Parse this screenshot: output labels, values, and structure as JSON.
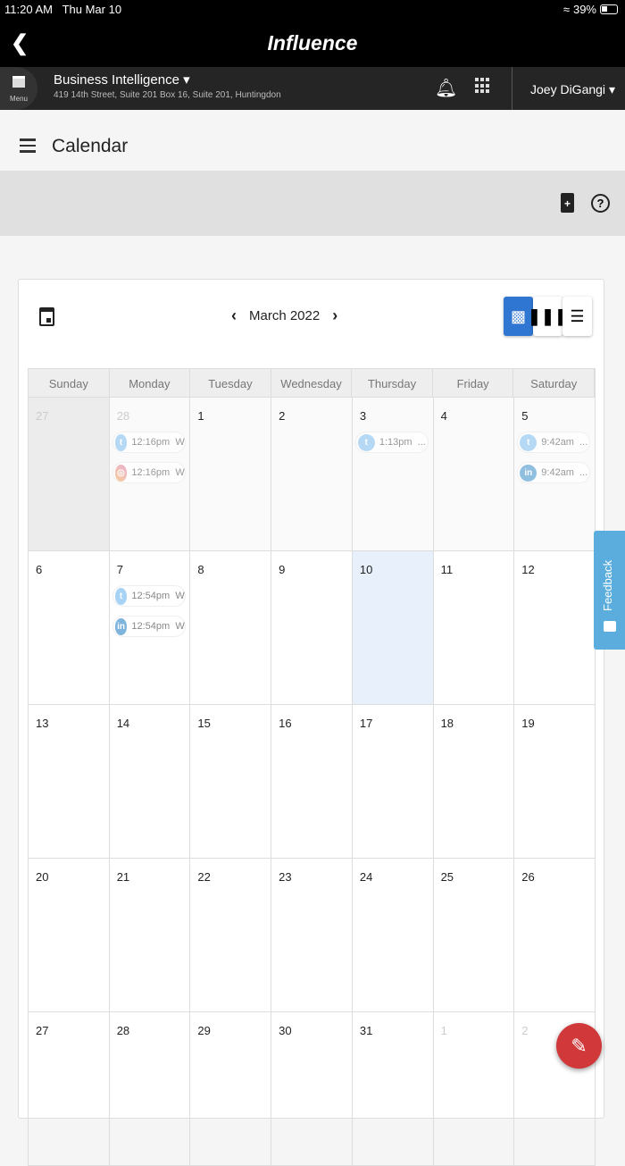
{
  "status": {
    "time": "11:20 AM",
    "date": "Thu Mar 10",
    "battery": "39%"
  },
  "app": {
    "title": "Influence",
    "menu_label": "Menu"
  },
  "nav": {
    "business": "Business Intelligence",
    "address": "419 14th Street, Suite 201 Box 16, Suite 201, Huntingdon",
    "user": "Joey DiGangi"
  },
  "page": {
    "title": "Calendar"
  },
  "calendar": {
    "month": "March 2022",
    "weekdays": [
      "Sunday",
      "Monday",
      "Tuesday",
      "Wednesday",
      "Thursday",
      "Friday",
      "Saturday"
    ],
    "weeks": [
      [
        {
          "d": "27",
          "cls": "prev other"
        },
        {
          "d": "28",
          "cls": "past other",
          "events": [
            {
              "net": "twitter",
              "time": "12:16pm",
              "snip": "W"
            },
            {
              "net": "instagram",
              "time": "12:16pm",
              "snip": "W"
            }
          ]
        },
        {
          "d": "1",
          "cls": "past"
        },
        {
          "d": "2",
          "cls": "past"
        },
        {
          "d": "3",
          "cls": "past",
          "events": [
            {
              "net": "twitter",
              "time": "1:13pm",
              "snip": "..."
            }
          ]
        },
        {
          "d": "4",
          "cls": "past"
        },
        {
          "d": "5",
          "cls": "past",
          "events": [
            {
              "net": "twitter",
              "time": "9:42am",
              "snip": "..."
            },
            {
              "net": "linkedin",
              "time": "9:42am",
              "snip": "..."
            }
          ]
        }
      ],
      [
        {
          "d": "6"
        },
        {
          "d": "7",
          "events": [
            {
              "net": "twitter",
              "time": "12:54pm",
              "snip": "W"
            },
            {
              "net": "linkedin",
              "time": "12:54pm",
              "snip": "W"
            }
          ]
        },
        {
          "d": "8"
        },
        {
          "d": "9"
        },
        {
          "d": "10",
          "cls": "today"
        },
        {
          "d": "11"
        },
        {
          "d": "12"
        }
      ],
      [
        {
          "d": "13"
        },
        {
          "d": "14"
        },
        {
          "d": "15"
        },
        {
          "d": "16"
        },
        {
          "d": "17"
        },
        {
          "d": "18"
        },
        {
          "d": "19"
        }
      ],
      [
        {
          "d": "20"
        },
        {
          "d": "21"
        },
        {
          "d": "22"
        },
        {
          "d": "23"
        },
        {
          "d": "24"
        },
        {
          "d": "25"
        },
        {
          "d": "26"
        }
      ],
      [
        {
          "d": "27"
        },
        {
          "d": "28"
        },
        {
          "d": "29"
        },
        {
          "d": "30"
        },
        {
          "d": "31"
        },
        {
          "d": "1",
          "cls": "other"
        },
        {
          "d": "2",
          "cls": "other"
        }
      ]
    ]
  },
  "feedback": "Feedback"
}
